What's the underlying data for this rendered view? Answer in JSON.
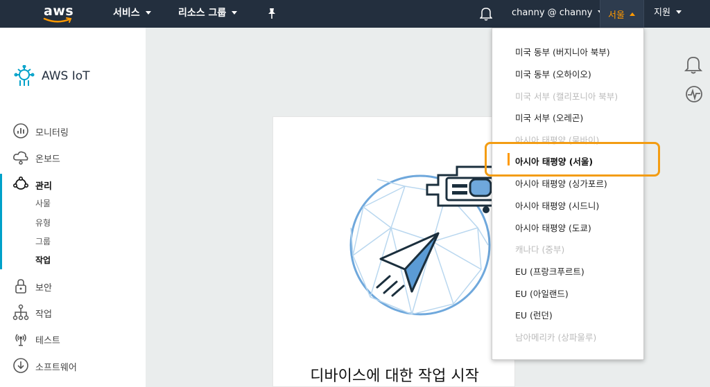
{
  "topnav": {
    "logo_text": "aws",
    "services": "서비스",
    "resource_groups": "리소스 그룹",
    "user": "channy @ channy",
    "region": "서울",
    "support": "지원"
  },
  "sidebar": {
    "brand": "AWS IoT",
    "items": [
      {
        "label": "모니터링",
        "icon": "chart-icon"
      },
      {
        "label": "온보드",
        "icon": "cloud-icon"
      },
      {
        "label": "관리",
        "icon": "manage-icon"
      },
      {
        "label": "보안",
        "icon": "lock-icon"
      },
      {
        "label": "작업",
        "icon": "hierarchy-icon"
      },
      {
        "label": "테스트",
        "icon": "broadcast-icon"
      },
      {
        "label": "소프트웨어",
        "icon": "download-icon"
      }
    ],
    "sub_items": [
      "사물",
      "유형",
      "그룹",
      "작업"
    ]
  },
  "main": {
    "card_title": "디바이스에 대한 작업 시작"
  },
  "region_dropdown": {
    "items": [
      {
        "label": "미국 동부 (버지니아 북부)",
        "state": "enabled"
      },
      {
        "label": "미국 동부 (오하이오)",
        "state": "enabled"
      },
      {
        "label": "미국 서부 (캘리포니아 북부)",
        "state": "disabled"
      },
      {
        "label": "미국 서부 (오레곤)",
        "state": "enabled"
      },
      {
        "label": "아시아 태평양 (뭄바이)",
        "state": "disabled"
      },
      {
        "label": "아시아 태평양 (서울)",
        "state": "selected"
      },
      {
        "label": "아시아 태평양 (싱가포르)",
        "state": "enabled"
      },
      {
        "label": "아시아 태평양 (시드니)",
        "state": "enabled"
      },
      {
        "label": "아시아 태평양 (도쿄)",
        "state": "enabled"
      },
      {
        "label": "캐나다 (중부)",
        "state": "disabled"
      },
      {
        "label": "EU (프랑크푸르트)",
        "state": "enabled"
      },
      {
        "label": "EU (아일랜드)",
        "state": "enabled"
      },
      {
        "label": "EU (런던)",
        "state": "enabled"
      },
      {
        "label": "남아메리카 (상파울루)",
        "state": "disabled"
      }
    ]
  },
  "colors": {
    "nav_bg": "#232f3e",
    "accent_orange": "#ff9900",
    "active_teal": "#00a1c9",
    "highlight": "#f39c12"
  }
}
